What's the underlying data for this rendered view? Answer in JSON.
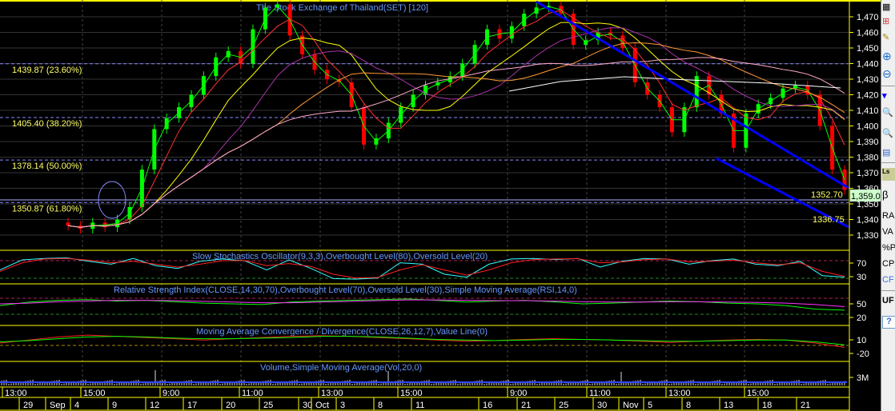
{
  "chart_data": {
    "type": "candlestick",
    "title": "The Stock Exchange of Thailand(SET) [120]",
    "ylim": [
      1325,
      1478
    ],
    "y_ticks": [
      1470,
      1460,
      1450,
      1440,
      1430,
      1420,
      1410,
      1400,
      1390,
      1380,
      1370,
      1360,
      1350,
      1340,
      1330
    ],
    "y_tick_labels": [
      "1,470",
      "1,460",
      "1,450",
      "1,440",
      "1,430",
      "1,420",
      "1,410",
      "1,400",
      "1,390",
      "1,380",
      "1,370",
      "1,360",
      "1,350",
      "1,340",
      "1,330"
    ],
    "closes": [
      1336,
      1334,
      1338,
      1335,
      1340,
      1348,
      1372,
      1398,
      1405,
      1412,
      1420,
      1432,
      1444,
      1448,
      1440,
      1462,
      1476,
      1478,
      1458,
      1446,
      1436,
      1430,
      1428,
      1412,
      1388,
      1392,
      1402,
      1412,
      1420,
      1426,
      1428,
      1432,
      1440,
      1452,
      1462,
      1456,
      1464,
      1472,
      1476,
      1477,
      1472,
      1452,
      1455,
      1460,
      1458,
      1450,
      1428,
      1420,
      1412,
      1396,
      1412,
      1432,
      1420,
      1408,
      1386,
      1408,
      1414,
      1418,
      1424,
      1426,
      1420,
      1400,
      1372,
      1359
    ],
    "fibonacci": [
      {
        "value": 1439.87,
        "label": "1439.87 (23.60%)"
      },
      {
        "value": 1405.4,
        "label": "1405.40 (38.20%)"
      },
      {
        "value": 1378.14,
        "label": "1378.14 (50.00%)"
      },
      {
        "value": 1350.87,
        "label": "1350.87 (61.80%)"
      }
    ],
    "annotations": {
      "level_a": "1352.70",
      "level_b": "1336.75",
      "last_price": "1,359.0"
    },
    "indicators": [
      {
        "name": "Slow Stochastics Oscillator(9,3,3),Overbought Level(80),Oversold Level(20)",
        "ticks": [
          "70",
          "30"
        ],
        "k": [
          40,
          75,
          80,
          82,
          70,
          60,
          80,
          55,
          45,
          70,
          78,
          72,
          40,
          75,
          45,
          10,
          8,
          12,
          65,
          60,
          25,
          15,
          60,
          78,
          80,
          76,
          80,
          50,
          70,
          80,
          78,
          60,
          72,
          78,
          60,
          55,
          70,
          20,
          15
        ],
        "d": [
          35,
          65,
          78,
          80,
          74,
          65,
          70,
          60,
          50,
          60,
          72,
          73,
          55,
          62,
          52,
          25,
          12,
          14,
          40,
          58,
          40,
          22,
          40,
          65,
          76,
          78,
          79,
          65,
          68,
          76,
          78,
          68,
          70,
          74,
          65,
          58,
          65,
          35,
          18
        ]
      },
      {
        "name": "Relative Strength Index(CLOSE,14,30,70),Overbought Level(70),Oversold Level(30),Simple Moving Average(RSI,14,0)",
        "ticks": [
          "50",
          "20"
        ],
        "rsi": [
          45,
          55,
          60,
          62,
          58,
          60,
          56,
          52,
          50,
          48,
          55,
          58,
          60,
          62,
          64,
          60,
          55,
          58,
          60,
          56,
          50,
          52,
          55,
          58,
          56,
          52,
          50,
          45,
          35,
          32
        ],
        "sma": [
          50,
          52,
          56,
          58,
          60,
          60,
          59,
          57,
          55,
          53,
          53,
          55,
          57,
          59,
          61,
          61,
          60,
          59,
          59,
          58,
          56,
          55,
          55,
          56,
          56,
          55,
          54,
          52,
          48,
          42
        ]
      },
      {
        "name": "Moving Average Convergence / Divergence(CLOSE,26,12,7),Value Line(0)",
        "ticks": [
          "10",
          "-20"
        ],
        "macd": [
          -5,
          0,
          5,
          8,
          6,
          4,
          2,
          0,
          2,
          4,
          6,
          7,
          6,
          4,
          2,
          0,
          -2,
          -1,
          1,
          2,
          1,
          0,
          -2,
          -4,
          -2,
          0,
          1,
          0,
          -5,
          -12
        ],
        "signal": [
          -3,
          -1,
          2,
          5,
          6,
          5,
          3,
          2,
          2,
          3,
          4,
          6,
          6,
          5,
          3,
          1,
          0,
          -1,
          0,
          1,
          1,
          0,
          -1,
          -2,
          -2,
          -1,
          0,
          0,
          -3,
          -8
        ]
      },
      {
        "name": "Volume,Simple Moving Average(Vol,20,0)",
        "ticks": [
          "3M"
        ]
      }
    ],
    "time_labels": [
      "13:00",
      "15:00",
      "9:00",
      "11:00",
      "13:00",
      "15:00",
      "9:00",
      "11:00",
      "13:00",
      "15:00"
    ],
    "date_labels": [
      "29",
      "Sep",
      "4",
      "9",
      "12",
      "17",
      "20",
      "25",
      "30",
      "Oct",
      "3",
      "8",
      "11",
      "16",
      "21",
      "25",
      "30",
      "Nov",
      "5",
      "8",
      "13",
      "18",
      "21"
    ]
  },
  "toolbar": {
    "items": [
      "β",
      "RA",
      "VA",
      "%P",
      "CP",
      "CF",
      "UF",
      "?"
    ],
    "icons": [
      "table-icon",
      "chart-add-icon",
      "properties-icon",
      "plus-icon",
      "minus-icon",
      "price-style-icon",
      "zoom-in-icon",
      "zoom-out-icon",
      "window-icon",
      "ls-icon"
    ]
  },
  "colors": {
    "up": "#00ff00",
    "down": "#ff0000",
    "axis": "#ffff00",
    "fib": "#8888ff",
    "trend": "#0000ff",
    "title": "#6699ff"
  }
}
